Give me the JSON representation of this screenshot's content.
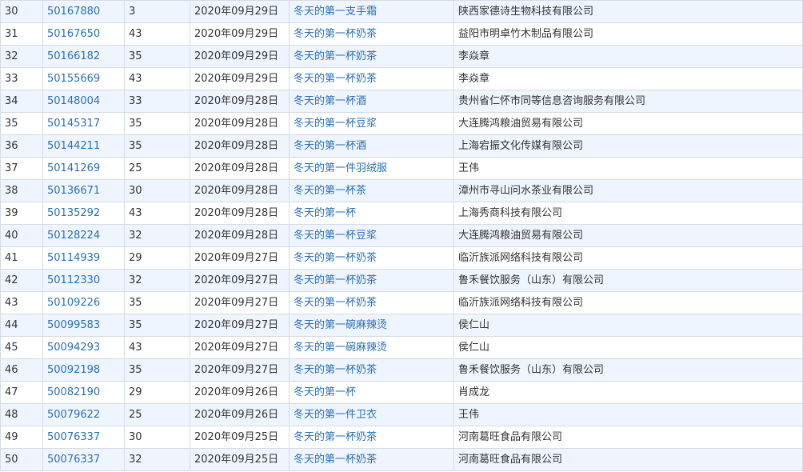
{
  "colors": {
    "link": "#2a6fb5",
    "text": "#333333",
    "row_alt": "#eef5ff",
    "border": "#d6dbe3"
  },
  "rows": [
    {
      "idx": "30",
      "reg": "50167880",
      "cls": "3",
      "date": "2020年09月29日",
      "name": "冬天的第一支手霜",
      "owner": "陕西家德诗生物科技有限公司"
    },
    {
      "idx": "31",
      "reg": "50167650",
      "cls": "43",
      "date": "2020年09月29日",
      "name": "冬天的第一杯奶茶",
      "owner": "益阳市明卓竹木制品有限公司"
    },
    {
      "idx": "32",
      "reg": "50166182",
      "cls": "35",
      "date": "2020年09月29日",
      "name": "冬天的第一杯奶茶",
      "owner": "李焱章"
    },
    {
      "idx": "33",
      "reg": "50155669",
      "cls": "43",
      "date": "2020年09月29日",
      "name": "冬天的第一杯奶茶",
      "owner": "李焱章"
    },
    {
      "idx": "34",
      "reg": "50148004",
      "cls": "33",
      "date": "2020年09月28日",
      "name": "冬天的第一杯酒",
      "owner": "贵州省仁怀市同等信息咨询服务有限公司"
    },
    {
      "idx": "35",
      "reg": "50145317",
      "cls": "35",
      "date": "2020年09月28日",
      "name": "冬天的第一杯豆浆",
      "owner": "大连腾鸿粮油贸易有限公司"
    },
    {
      "idx": "36",
      "reg": "50144211",
      "cls": "35",
      "date": "2020年09月28日",
      "name": "冬天的第一杯酒",
      "owner": "上海宕振文化传媒有限公司"
    },
    {
      "idx": "37",
      "reg": "50141269",
      "cls": "25",
      "date": "2020年09月28日",
      "name": "冬天的第一件羽绒服",
      "owner": "王伟"
    },
    {
      "idx": "38",
      "reg": "50136671",
      "cls": "30",
      "date": "2020年09月28日",
      "name": "冬天的第一杯茶",
      "owner": "漳州市寻山问水茶业有限公司"
    },
    {
      "idx": "39",
      "reg": "50135292",
      "cls": "43",
      "date": "2020年09月28日",
      "name": "冬天的第一杯",
      "owner": "上海秀商科技有限公司"
    },
    {
      "idx": "40",
      "reg": "50128224",
      "cls": "32",
      "date": "2020年09月28日",
      "name": "冬天的第一杯豆浆",
      "owner": "大连腾鸿粮油贸易有限公司"
    },
    {
      "idx": "41",
      "reg": "50114939",
      "cls": "29",
      "date": "2020年09月27日",
      "name": "冬天的第一杯奶茶",
      "owner": "临沂族派网络科技有限公司"
    },
    {
      "idx": "42",
      "reg": "50112330",
      "cls": "32",
      "date": "2020年09月27日",
      "name": "冬天的第一杯奶茶",
      "owner": "鲁禾餐饮服务（山东）有限公司"
    },
    {
      "idx": "43",
      "reg": "50109226",
      "cls": "35",
      "date": "2020年09月27日",
      "name": "冬天的第一杯奶茶",
      "owner": "临沂族派网络科技有限公司"
    },
    {
      "idx": "44",
      "reg": "50099583",
      "cls": "35",
      "date": "2020年09月27日",
      "name": "冬天的第一碗麻辣烫",
      "owner": "侯仁山"
    },
    {
      "idx": "45",
      "reg": "50094293",
      "cls": "43",
      "date": "2020年09月27日",
      "name": "冬天的第一碗麻辣烫",
      "owner": "侯仁山"
    },
    {
      "idx": "46",
      "reg": "50092198",
      "cls": "35",
      "date": "2020年09月27日",
      "name": "冬天的第一杯奶茶",
      "owner": "鲁禾餐饮服务（山东）有限公司"
    },
    {
      "idx": "47",
      "reg": "50082190",
      "cls": "29",
      "date": "2020年09月26日",
      "name": "冬天的第一杯",
      "owner": "肖成龙"
    },
    {
      "idx": "48",
      "reg": "50079622",
      "cls": "25",
      "date": "2020年09月26日",
      "name": "冬天的第一件卫衣",
      "owner": "王伟"
    },
    {
      "idx": "49",
      "reg": "50076337",
      "cls": "30",
      "date": "2020年09月25日",
      "name": "冬天的第一杯奶茶",
      "owner": "河南葛旺食品有限公司"
    },
    {
      "idx": "50",
      "reg": "50076337",
      "cls": "32",
      "date": "2020年09月25日",
      "name": "冬天的第一杯奶茶",
      "owner": "河南葛旺食品有限公司"
    }
  ]
}
